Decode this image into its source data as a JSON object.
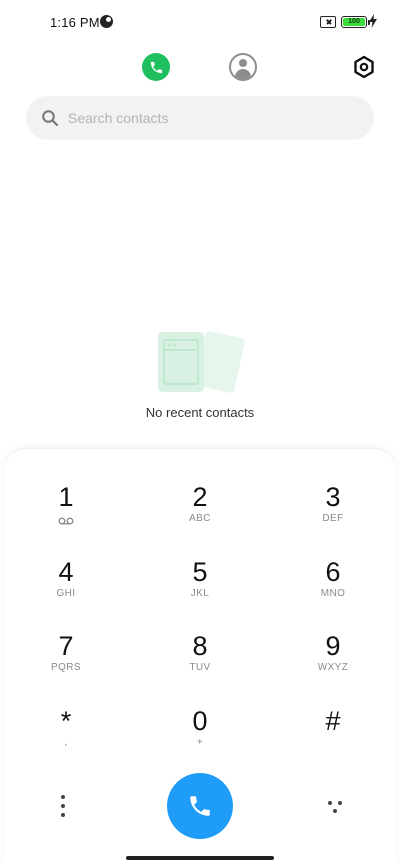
{
  "status_bar": {
    "time": "1:16 PM",
    "battery_level": "100",
    "icons": [
      "do-not-disturb-icon",
      "no-sim-icon",
      "battery-icon",
      "charging-icon"
    ]
  },
  "top_nav": {
    "tabs": [
      {
        "name": "phone",
        "icon": "phone-icon",
        "active": true,
        "color": "#1fbf5f"
      },
      {
        "name": "contacts",
        "icon": "person-icon",
        "active": false
      }
    ],
    "settings_icon": "settings-icon"
  },
  "search": {
    "placeholder": "Search contacts"
  },
  "empty_state": {
    "text": "No recent contacts",
    "illustration_color": "#e3f5ea"
  },
  "dialpad": {
    "keys": [
      {
        "digit": "1",
        "letters": ""
      },
      {
        "digit": "2",
        "letters": "ABC"
      },
      {
        "digit": "3",
        "letters": "DEF"
      },
      {
        "digit": "4",
        "letters": "GHI"
      },
      {
        "digit": "5",
        "letters": "JKL"
      },
      {
        "digit": "6",
        "letters": "MNO"
      },
      {
        "digit": "7",
        "letters": "PQRS"
      },
      {
        "digit": "8",
        "letters": "TUV"
      },
      {
        "digit": "9",
        "letters": "WXYZ"
      },
      {
        "digit": "*",
        "letters": ","
      },
      {
        "digit": "0",
        "letters": "+"
      },
      {
        "digit": "#",
        "letters": ""
      }
    ],
    "call_button_color": "#1e9cf7"
  }
}
